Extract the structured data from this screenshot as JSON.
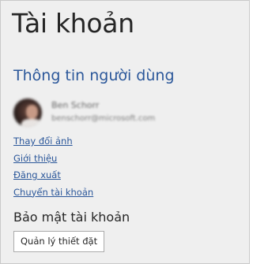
{
  "page": {
    "title": "Tài khoản"
  },
  "user_info": {
    "heading": "Thông tin người dùng",
    "name": "Ben Schorr",
    "email": "benschorr@microsoft.com"
  },
  "links": [
    {
      "label": "Thay đổi ảnh"
    },
    {
      "label": "Giới thiệu"
    },
    {
      "label": "Đăng xuất"
    },
    {
      "label": "Chuyển tài khoản"
    }
  ],
  "security": {
    "heading": "Bảo mật tài khoản",
    "manage_label": "Quản lý thiết đặt"
  },
  "colors": {
    "accent": "#2b579a",
    "background": "#efefef",
    "text": "#262626"
  }
}
